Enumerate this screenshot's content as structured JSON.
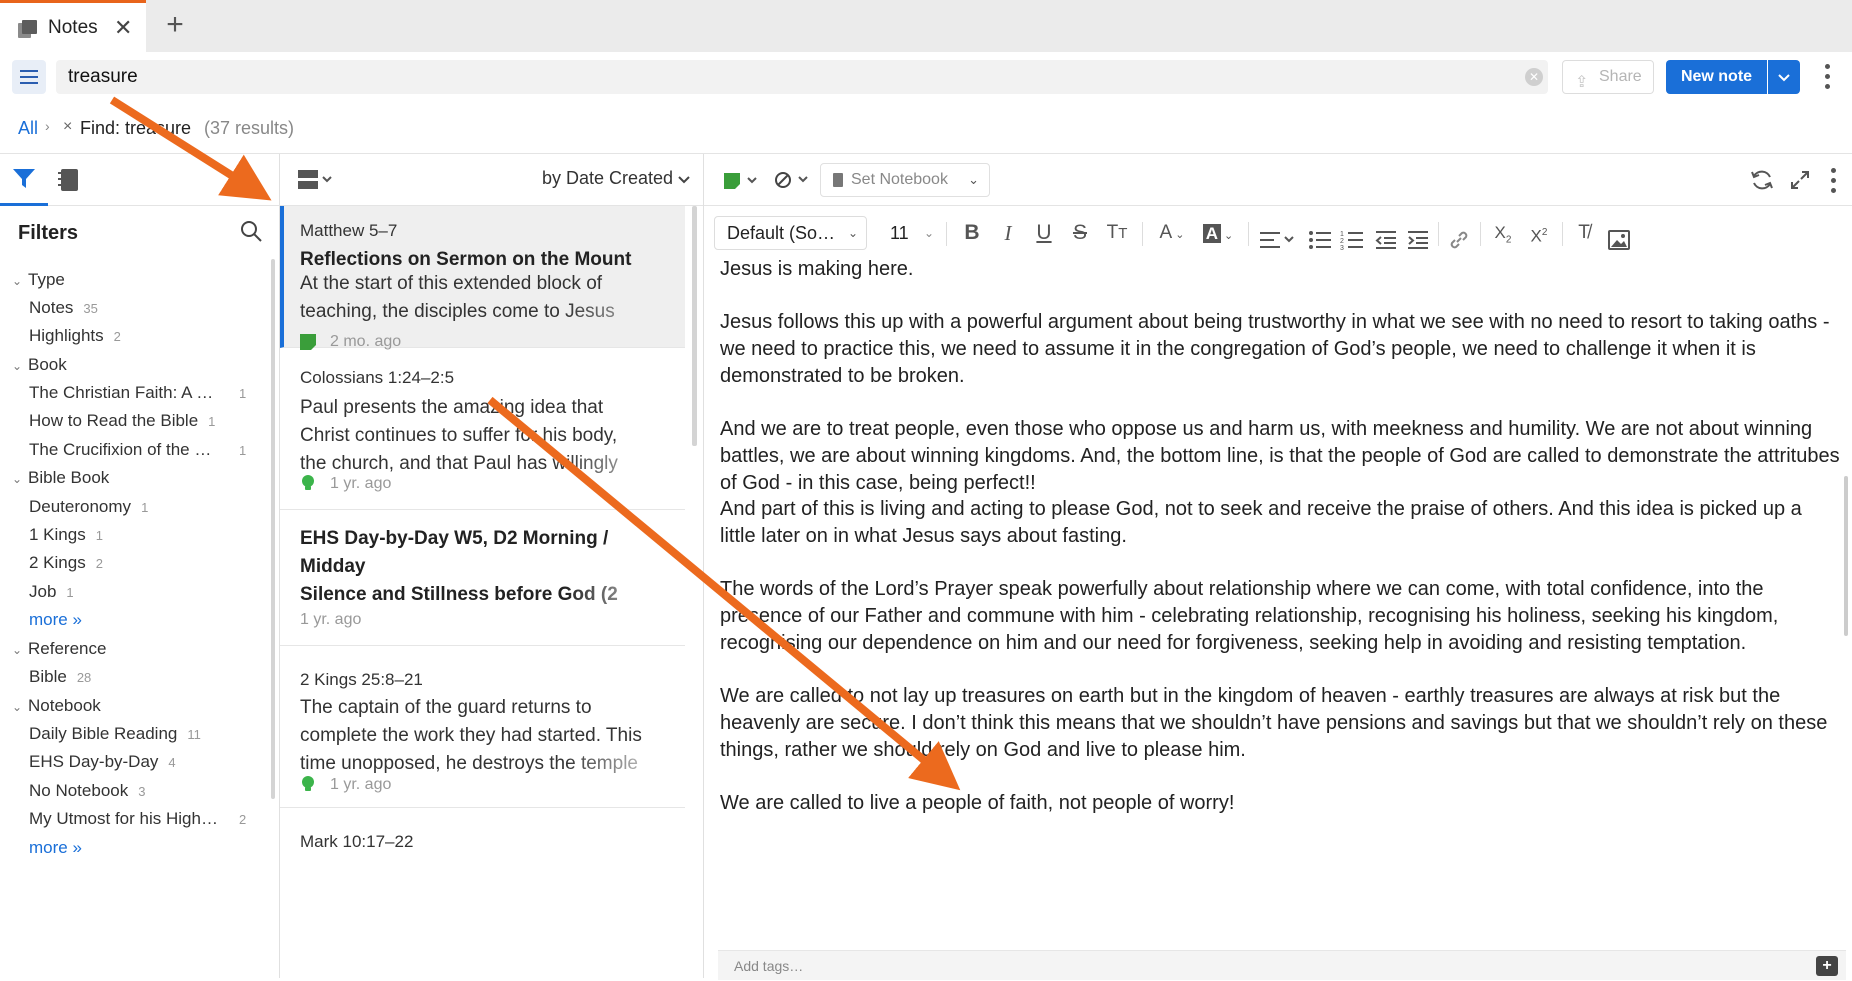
{
  "tab": {
    "title": "Notes",
    "close": "✕",
    "new_tab": "+"
  },
  "toolbar": {
    "search_value": "treasure",
    "search_clear": "✕",
    "share_label": "Share",
    "new_note_label": "New note",
    "new_note_dropdown": "⌄"
  },
  "breadcrumb": {
    "all": "All",
    "separator": "›",
    "remove": "×",
    "find_label": "Find: treasure",
    "result_count": "(37 results)"
  },
  "filters": {
    "title": "Filters",
    "sections": [
      {
        "label": "Type",
        "items": [
          {
            "label": "Notes",
            "count": "35"
          },
          {
            "label": "Highlights",
            "count": "2"
          }
        ]
      },
      {
        "label": "Book",
        "items": [
          {
            "label": "The Christian Faith: A S…",
            "count": "1"
          },
          {
            "label": "How to Read the Bible",
            "count": "1"
          },
          {
            "label": "The Crucifixion of the W…",
            "count": "1"
          }
        ]
      },
      {
        "label": "Bible Book",
        "items": [
          {
            "label": "Deuteronomy",
            "count": "1"
          },
          {
            "label": "1 Kings",
            "count": "1"
          },
          {
            "label": "2 Kings",
            "count": "2"
          },
          {
            "label": "Job",
            "count": "1"
          }
        ],
        "more": "more »"
      },
      {
        "label": "Reference",
        "items": [
          {
            "label": "Bible",
            "count": "28"
          }
        ]
      },
      {
        "label": "Notebook",
        "items": [
          {
            "label": "Daily Bible Reading",
            "count": "11"
          },
          {
            "label": "EHS Day-by-Day",
            "count": "4"
          },
          {
            "label": "No Notebook",
            "count": "3"
          },
          {
            "label": "My Utmost for his Highe…",
            "count": "2"
          }
        ],
        "more": "more »"
      }
    ]
  },
  "note_list": {
    "sort_label": "by Date Created",
    "notes": [
      {
        "reference": "Matthew 5–7",
        "title": "Reflections on Sermon on the Mount",
        "excerpt": [
          "At the start of this extended block of",
          "teaching, the disciples come to Jesus"
        ],
        "time": "2 mo. ago",
        "icon": "note-icon-green"
      },
      {
        "reference": "Colossians 1:24–2:5",
        "excerpt": [
          "Paul presents the amazing idea that",
          "Christ continues to suffer for his body,",
          "the church, and that Paul has willingly"
        ],
        "time": "1 yr. ago",
        "icon": "highlight-icon-green"
      },
      {
        "title_lines": [
          "EHS Day-by-Day W5, D2 Morning /",
          "Midday",
          "Silence and Stillness before God (2"
        ],
        "time": "1 yr. ago"
      },
      {
        "reference": "2 Kings 25:8–21",
        "excerpt": [
          "The captain of the guard returns to",
          "complete the work they had started. This",
          "time unopposed, he destroys the temple"
        ],
        "time": "1 yr. ago",
        "icon": "highlight-icon-green"
      },
      {
        "reference": "Mark 10:17–22"
      }
    ]
  },
  "editor": {
    "notebook_label": "Set Notebook",
    "font_family": "Default (So…",
    "font_size": "11",
    "paragraphs": [
      "Jesus is making here.",
      "Jesus follows this up with a powerful argument about being trustworthy in what we see with no need to resort to taking oaths - we need to practice this, we need to assume it in the congregation of God’s people, we need to challenge it when it is demonstrated to be broken.",
      "And we are to treat people, even those who oppose us and harm us, with meekness and humility. We are not about winning battles, we are about winning kingdoms. And, the bottom line, is that the people of God are called to demonstrate the attritubes of God - in this case, being perfect!!",
      "And part of this is living and acting to please God, not to seek and receive the praise of others. And this idea is picked up a little later on in what Jesus says about fasting.",
      "The words of the Lord’s Prayer speak powerfully about relationship where we can come, with total confidence, into the presence of our Father and commune with him - celebrating relationship, recognising his holiness, seeking his kingdom, recognising our dependence on him and our need for forgiveness, seeking help in avoiding and resisting temptation.",
      "We are called to not lay up treasures on earth but in the kingdom of heaven - earthly treasures are always at risk but the heavenly are secure. I don’t think this means that we shouldn’t have pensions and savings but that we shouldn’t rely on these things, rather we should rely on God and live to please him.",
      "We are called to live a people of faith, not people of worry!"
    ],
    "tags_placeholder": "Add tags…",
    "add_tag": "+"
  },
  "colors": {
    "accent": "#1a6fd8",
    "tab_highlight": "#e8641b",
    "arrow": "#ec6a1e",
    "note_green": "#3cb44b"
  }
}
